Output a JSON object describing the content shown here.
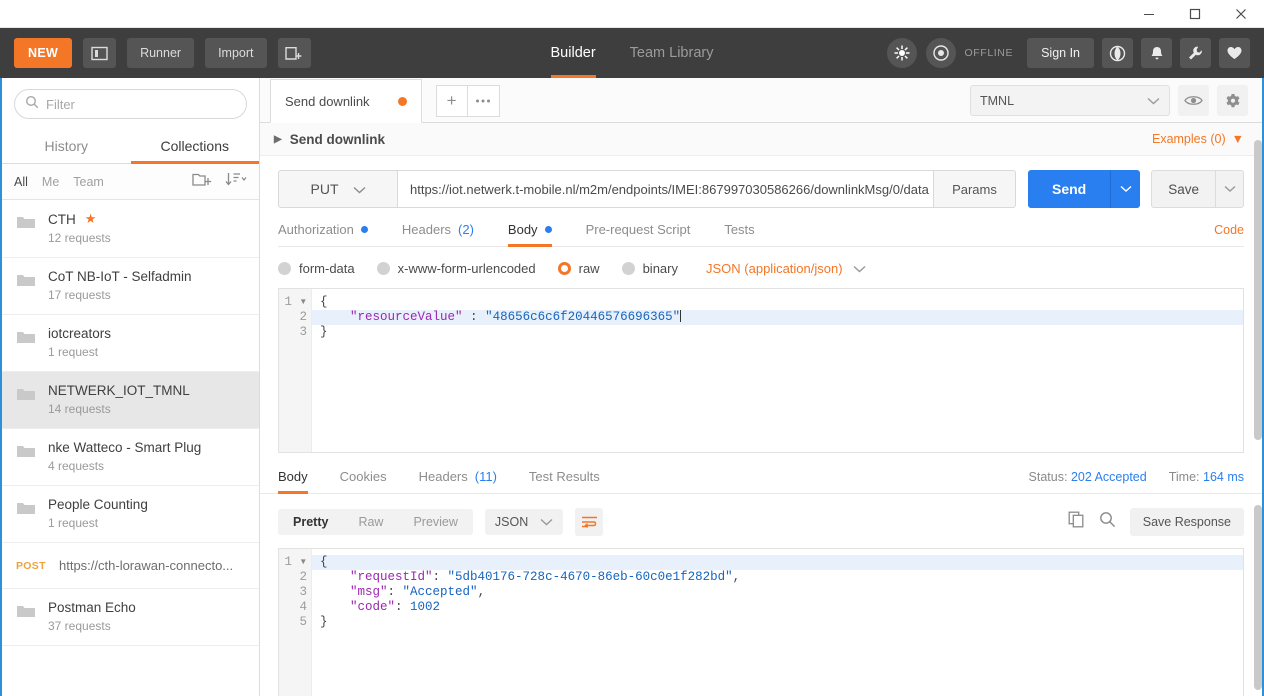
{
  "window": {
    "minimize_icon": "minimize-icon",
    "maximize_icon": "maximize-icon",
    "close_icon": "close-icon"
  },
  "topnav": {
    "new_label": "NEW",
    "sidebar_toggle_icon": "sidebar-toggle-icon",
    "runner_label": "Runner",
    "import_label": "Import",
    "new_window_icon": "new-window-icon",
    "tabs": [
      {
        "label": "Builder",
        "active": true
      },
      {
        "label": "Team Library",
        "active": false
      }
    ],
    "interceptor_icon": "interceptor-icon",
    "sync_icon": "sync-status-icon",
    "offline_label": "OFFLINE",
    "signin_label": "Sign In",
    "globe_icon": "globe-icon",
    "bell_icon": "notifications-bell-icon",
    "wrench_icon": "settings-wrench-icon",
    "heart_icon": "heart-icon"
  },
  "sidebar": {
    "search_placeholder": "Filter",
    "search_value": "",
    "search_icon": "search-icon",
    "tabs": [
      {
        "label": "History",
        "active": false
      },
      {
        "label": "Collections",
        "active": true
      }
    ],
    "scopes": [
      {
        "label": "All",
        "active": true
      },
      {
        "label": "Me",
        "active": false
      },
      {
        "label": "Team",
        "active": false
      }
    ],
    "new_folder_icon": "new-folder-icon",
    "sort_icon": "sort-icon",
    "collections": [
      {
        "name": "CTH",
        "count": "12 requests",
        "starred": true,
        "selected": false,
        "type": "folder"
      },
      {
        "name": "CoT NB-IoT - Selfadmin",
        "count": "17 requests",
        "starred": false,
        "selected": false,
        "type": "folder"
      },
      {
        "name": "iotcreators",
        "count": "1 request",
        "starred": false,
        "selected": false,
        "type": "folder"
      },
      {
        "name": "NETWERK_IOT_TMNL",
        "count": "14 requests",
        "starred": false,
        "selected": true,
        "type": "folder"
      },
      {
        "name": "nke Watteco - Smart Plug",
        "count": "4 requests",
        "starred": false,
        "selected": false,
        "type": "folder"
      },
      {
        "name": "People Counting",
        "count": "1 request",
        "starred": false,
        "selected": false,
        "type": "folder"
      },
      {
        "name": "https://cth-lorawan-connecto...",
        "method": "POST",
        "selected": false,
        "type": "request"
      },
      {
        "name": "Postman Echo",
        "count": "37 requests",
        "starred": false,
        "selected": false,
        "type": "folder"
      }
    ]
  },
  "request_tabs": {
    "open": [
      {
        "label": "Send downlink",
        "unsaved": true,
        "active": true
      }
    ],
    "add_label": "+",
    "more_label": "•••"
  },
  "environment": {
    "selected": "TMNL",
    "eye_icon": "quick-look-eye-icon",
    "gear_icon": "manage-environments-gear-icon"
  },
  "request": {
    "breadcrumb": "Send downlink",
    "examples_label": "Examples (0)",
    "method": "PUT",
    "url": "https://iot.netwerk.t-mobile.nl/m2m/endpoints/IMEI:867997030586266/downlinkMsg/0/data",
    "params_label": "Params",
    "send_label": "Send",
    "save_label": "Save",
    "code_label": "Code",
    "tabs": [
      {
        "label": "Authorization",
        "badge_dot": true,
        "count": "",
        "active": false
      },
      {
        "label": "Headers",
        "badge_dot": false,
        "count": "(2)",
        "active": false
      },
      {
        "label": "Body",
        "badge_dot": true,
        "count": "",
        "active": true
      },
      {
        "label": "Pre-request Script",
        "badge_dot": false,
        "count": "",
        "active": false
      },
      {
        "label": "Tests",
        "badge_dot": false,
        "count": "",
        "active": false
      }
    ],
    "body_types": [
      {
        "label": "form-data",
        "selected": false
      },
      {
        "label": "x-www-form-urlencoded",
        "selected": false
      },
      {
        "label": "raw",
        "selected": true
      },
      {
        "label": "binary",
        "selected": false
      }
    ],
    "raw_format": "JSON (application/json)",
    "body_lines": [
      {
        "num": "1",
        "fold": true,
        "highlight": false,
        "tokens": [
          {
            "t": "{",
            "c": "p"
          }
        ]
      },
      {
        "num": "2",
        "fold": false,
        "highlight": true,
        "tokens": [
          {
            "t": "    ",
            "c": "p"
          },
          {
            "t": "\"resourceValue\"",
            "c": "k"
          },
          {
            "t": " : ",
            "c": "p"
          },
          {
            "t": "\"48656c6c6f20446576696365\"",
            "c": "s"
          }
        ]
      },
      {
        "num": "3",
        "fold": false,
        "highlight": false,
        "tokens": [
          {
            "t": "}",
            "c": "p"
          }
        ]
      }
    ]
  },
  "response": {
    "tabs": [
      {
        "label": "Body",
        "count": "",
        "active": true
      },
      {
        "label": "Cookies",
        "count": "",
        "active": false
      },
      {
        "label": "Headers",
        "count": "(11)",
        "active": false
      },
      {
        "label": "Test Results",
        "count": "",
        "active": false
      }
    ],
    "status_label": "Status:",
    "status_value": "202 Accepted",
    "time_label": "Time:",
    "time_value": "164 ms",
    "view_modes": [
      {
        "label": "Pretty",
        "active": true
      },
      {
        "label": "Raw",
        "active": false
      },
      {
        "label": "Preview",
        "active": false
      }
    ],
    "format": "JSON",
    "wrap_icon": "word-wrap-icon",
    "copy_icon": "copy-icon",
    "search_icon": "search-icon",
    "save_response_label": "Save Response",
    "body_lines": [
      {
        "num": "1",
        "fold": true,
        "highlight": true,
        "tokens": [
          {
            "t": "{",
            "c": "p"
          }
        ]
      },
      {
        "num": "2",
        "fold": false,
        "highlight": false,
        "tokens": [
          {
            "t": "    ",
            "c": "p"
          },
          {
            "t": "\"requestId\"",
            "c": "k"
          },
          {
            "t": ": ",
            "c": "p"
          },
          {
            "t": "\"5db40176-728c-4670-86eb-60c0e1f282bd\"",
            "c": "s"
          },
          {
            "t": ",",
            "c": "p"
          }
        ]
      },
      {
        "num": "3",
        "fold": false,
        "highlight": false,
        "tokens": [
          {
            "t": "    ",
            "c": "p"
          },
          {
            "t": "\"msg\"",
            "c": "k"
          },
          {
            "t": ": ",
            "c": "p"
          },
          {
            "t": "\"Accepted\"",
            "c": "s"
          },
          {
            "t": ",",
            "c": "p"
          }
        ]
      },
      {
        "num": "4",
        "fold": false,
        "highlight": false,
        "tokens": [
          {
            "t": "    ",
            "c": "p"
          },
          {
            "t": "\"code\"",
            "c": "k"
          },
          {
            "t": ": ",
            "c": "p"
          },
          {
            "t": "1002",
            "c": "n"
          }
        ]
      },
      {
        "num": "5",
        "fold": false,
        "highlight": false,
        "tokens": [
          {
            "t": "}",
            "c": "p"
          }
        ]
      }
    ]
  },
  "colors": {
    "accent_orange": "#f37726",
    "send_blue": "#2a7ff0",
    "dark_nav": "#3e3e3e",
    "window_border_blue": "#2f8fd8"
  }
}
